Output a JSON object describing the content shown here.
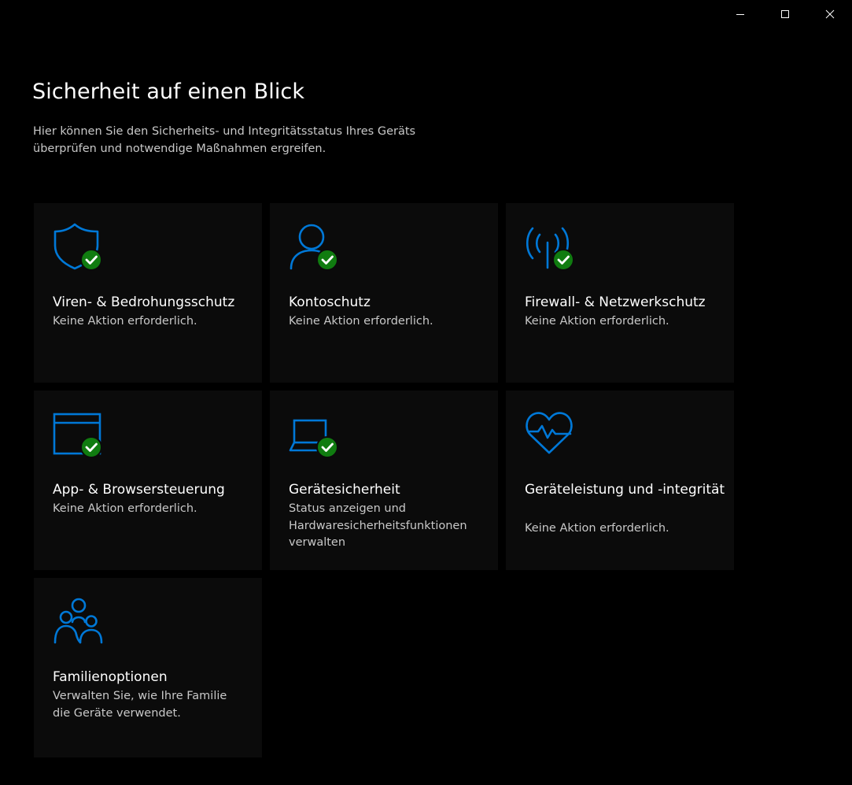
{
  "window": {
    "minimize_icon": "minimize-icon",
    "maximize_icon": "maximize-icon",
    "close_icon": "close-icon"
  },
  "header": {
    "title": "Sicherheit auf einen Blick",
    "subtitle": "Hier können Sie den Sicherheits- und Integritätsstatus Ihres Geräts überprüfen und notwendige Maßnahmen ergreifen."
  },
  "colors": {
    "accent": "#0078d7",
    "ok_badge": "#107c10",
    "tile_bg": "#0b0b0b",
    "background": "#000000"
  },
  "tiles": [
    {
      "icon": "shield-icon",
      "title": "Viren- & Bedrohungsschutz",
      "desc": "Keine Aktion erforderlich.",
      "status": "ok"
    },
    {
      "icon": "person-icon",
      "title": "Kontoschutz",
      "desc": "Keine Aktion erforderlich.",
      "status": "ok"
    },
    {
      "icon": "antenna-icon",
      "title": "Firewall- & Netzwerkschutz",
      "desc": "Keine Aktion erforderlich.",
      "status": "ok"
    },
    {
      "icon": "browser-window-icon",
      "title": "App- & Browsersteuerung",
      "desc": "Keine Aktion erforderlich.",
      "status": "ok"
    },
    {
      "icon": "laptop-icon",
      "title": "Gerätesicherheit",
      "desc": "Status anzeigen und Hardwaresicherheitsfunktionen verwalten",
      "status": "ok"
    },
    {
      "icon": "heart-pulse-icon",
      "title": "Geräteleistung und -integrität",
      "desc": "Keine Aktion erforderlich.",
      "status": "none"
    },
    {
      "icon": "family-icon",
      "title": "Familienoptionen",
      "desc": "Verwalten Sie, wie Ihre Familie die Geräte verwendet.",
      "status": "none"
    }
  ]
}
